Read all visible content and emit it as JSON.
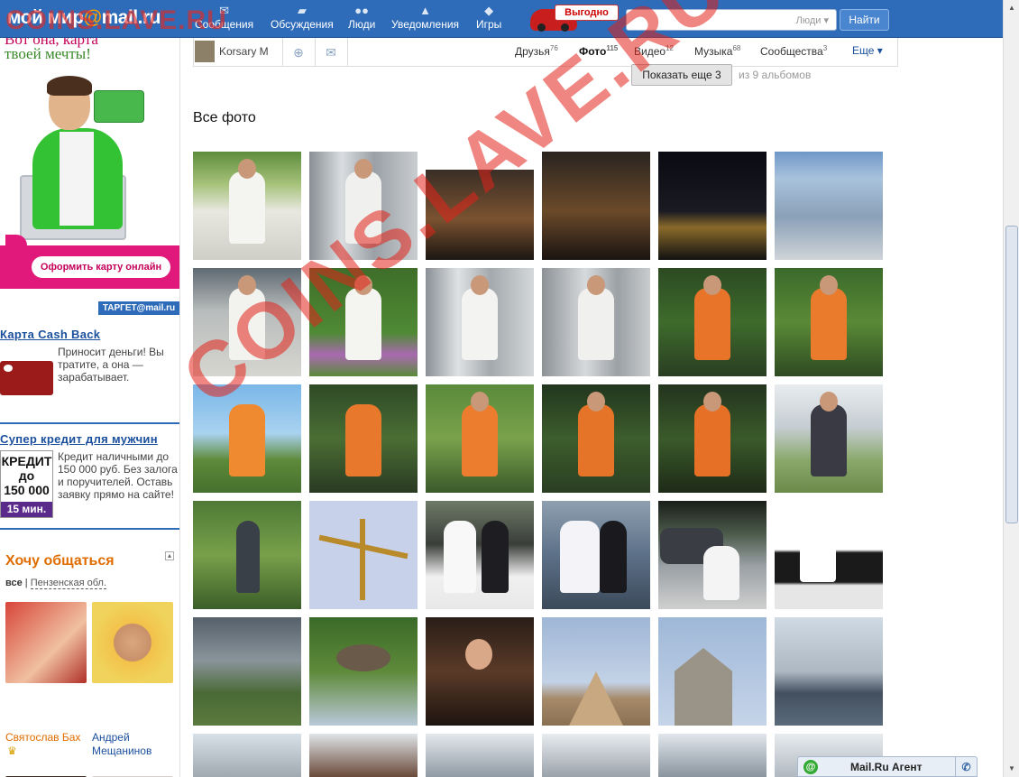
{
  "topbar": {
    "logo_main": "мой мир",
    "logo_at": "@",
    "logo_domain": "mail.ru",
    "nav": [
      {
        "label": "Сообщения",
        "icon": "envelope-icon"
      },
      {
        "label": "Обсуждения",
        "icon": "chat-icon"
      },
      {
        "label": "Люди",
        "icon": "people-icon"
      },
      {
        "label": "Уведомления",
        "icon": "bell-icon"
      },
      {
        "label": "Игры",
        "icon": "gamepad-icon"
      }
    ],
    "promo_label": "Выгодно",
    "search_value": "",
    "search_scope": "Люди",
    "search_button": "Найти"
  },
  "left_ads": {
    "banner_line1": "Вот она, карта",
    "banner_line2": "твоей мечты!",
    "banner_button": "Оформить карту онлайн",
    "target_label": "ТАРГЕТ@mail.ru",
    "ad1_title": "Карта Cash Back",
    "ad1_text": "Приносит деньги! Вы тратите, а она — зарабатывает.",
    "ad2_title": "Супер кредит для мужчин",
    "ad2_text": "Кредит наличными до 150 000 руб. Без залога и поручителей. Оставь заявку прямо на сайте!",
    "ad2_img_line1": "КРЕДИТ",
    "ad2_img_line2": "до",
    "ad2_img_line3": "150 000 р",
    "ad2_img_badge": "15 мин."
  },
  "chat": {
    "title": "Хочу общаться",
    "region_all": "все",
    "region_sep": "|",
    "region_name": "Пензенская обл.",
    "people": [
      {
        "name": "Святослав Бах",
        "crown": "♛"
      },
      {
        "name": "Андрей Мещанинов"
      }
    ]
  },
  "profile": {
    "name": "Korsary M",
    "tabs": [
      {
        "label": "Друзья",
        "count": "76"
      },
      {
        "label": "Фото",
        "count": "115"
      },
      {
        "label": "Видео",
        "count": "12"
      },
      {
        "label": "Музыка",
        "count": "68"
      },
      {
        "label": "Сообщества",
        "count": "3"
      }
    ],
    "more_label": "Еще ▾"
  },
  "albums": {
    "show_more": "Показать еще 3",
    "of_albums": "из 9 альбомов"
  },
  "photos": {
    "section_title": "Все фото"
  },
  "agent": {
    "label": "Mail.Ru Агент"
  },
  "watermark": {
    "small": "COINS.LAVE.RU",
    "large": "COINS.LAVE.RU"
  },
  "colors": {
    "topbar": "#2e6bb8",
    "accent_orange": "#e06c00",
    "link_blue": "#1a4f9c"
  }
}
